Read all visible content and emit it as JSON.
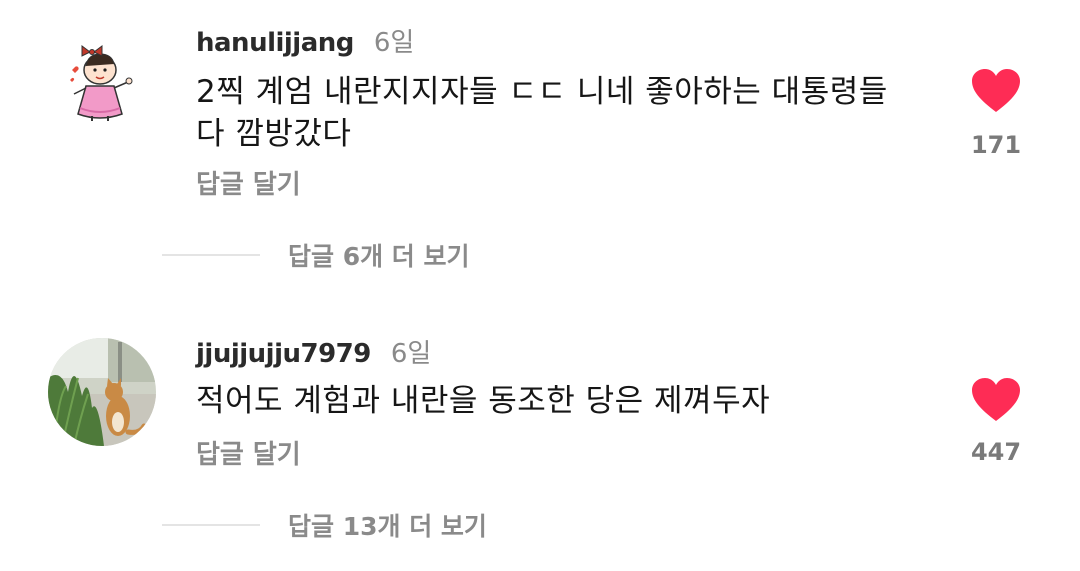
{
  "comments": [
    {
      "username": "hanulijjang",
      "time": "6일",
      "text_line1": "2찍 계엄 내란지지자들 ㄷㄷ 니네 좋아하는 대통령들",
      "text_line2": "다 깜방갔다",
      "reply_label": "답글 달기",
      "likes": "171",
      "more_replies_label": "답글 6개 더 보기",
      "avatar_icon": "cartoon-girl-avatar",
      "like_color": "#fe2c55"
    },
    {
      "username": "jjujjujju7979",
      "time": "6일",
      "text_line1": "적어도 계험과 내란을 동조한 당은 제껴두자",
      "reply_label": "답글 달기",
      "likes": "447",
      "more_replies_label": "답글 13개 더 보기",
      "avatar_icon": "cat-photo-avatar",
      "like_color": "#fe2c55"
    }
  ]
}
